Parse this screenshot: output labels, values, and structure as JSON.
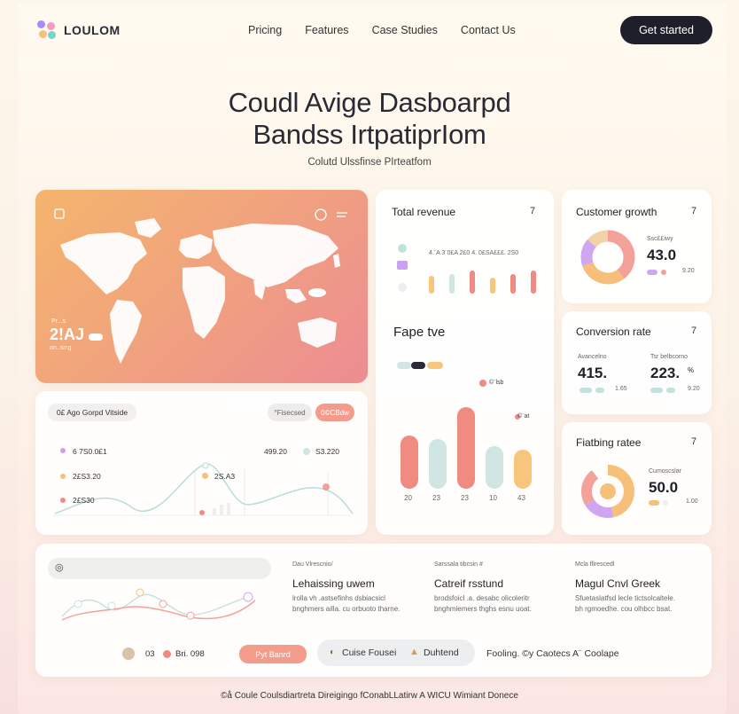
{
  "nav": {
    "brand": "LOULOM",
    "links": [
      "Pricing",
      "Features",
      "Case Studies",
      "Contact Us"
    ],
    "cta": "Get started"
  },
  "hero": {
    "title_line1": "Coudl Avige Dasboarpd",
    "title_line2": "Bandss IrtpatiprIom",
    "subtitle": "Colutd Ulssfinse PIrteatfom"
  },
  "map_card": {
    "stat_label": "Pr...s",
    "stat_value": "2!AJ",
    "stat_sub": "on..sing"
  },
  "line_card": {
    "filter_label": "0£ Ago Gorpd Vitside",
    "pill_a": "°Fisecsed",
    "pill_b": "0©CBdw",
    "rows": [
      {
        "label": "6 7S0.0£1",
        "right_value": "499.20",
        "right_value2": "S3.220"
      },
      {
        "label": "2£S3.20",
        "right_value": "2S.A3"
      },
      {
        "label": "2£S30"
      }
    ]
  },
  "revenue_card": {
    "title": "Total revenue",
    "arrow": "7",
    "top_labels": "4.¨A 3¨0£A 2£0   4. 0£SA£££. 2S0",
    "section_title": "Fape tve",
    "tooltip1": "©¨lsb",
    "tooltip2": "©¨at",
    "bar_labels": [
      "20",
      "23",
      "23",
      "10",
      "43"
    ],
    "colors": {
      "coral": "#f08b82",
      "mint": "#cfe6e2",
      "peach": "#f7c67c"
    }
  },
  "customer_growth": {
    "title": "Customer growth",
    "arrow": "7",
    "label": "Ssc££iwy",
    "value": "43.0",
    "sub": "9.20"
  },
  "conversion": {
    "title": "Conversion rate",
    "arrow": "7",
    "left_label": "Avancelno",
    "left_value": "415.",
    "left_sub": "1.65",
    "right_label": "Tsr belbcorno",
    "right_value": "223.",
    "right_sup": "%",
    "right_sub": "9.20"
  },
  "rating": {
    "title": "Fiatbing ratee",
    "arrow": "7",
    "label": "Cumoscslar",
    "value": "50.0",
    "sub": "1.00"
  },
  "bottom": {
    "cols": [
      {
        "small": "Dau Vlrescnio/",
        "title": "Lehaissing uwem",
        "text1": "lrolla vh .astsefinhs dsbiacsicl",
        "text2": "bnghmers ailla. cu orbuoto tharne."
      },
      {
        "small": "Sarssala tibcsin #",
        "title": "Catreif rsstund",
        "text1": "brodsfoicl .a. desabc olicoleritr",
        "text2": "bnghmiemers thghs esnu uoat."
      },
      {
        "small": "Mcla fllrescedl",
        "title": "Magul Cnvl Greek",
        "text1": "Sfuetaslatfsd lecle tictsolcaltele.",
        "text2": "bh rgmoedhe. cou olhbcc bsat."
      }
    ],
    "chip_value": "03",
    "chip_text": "Bri. 098",
    "button_label": "Pyt Banrd",
    "toggle_a": "Cuise Fousei",
    "toggle_b": "Duhtend",
    "trailing": "Fooling.   ©y Caotecs   A¨ Coolape"
  },
  "footer": {
    "text": "©å Coule Coulsdiartreta Direigingo fConabLLatirw A WICU Wimiant Donece"
  }
}
